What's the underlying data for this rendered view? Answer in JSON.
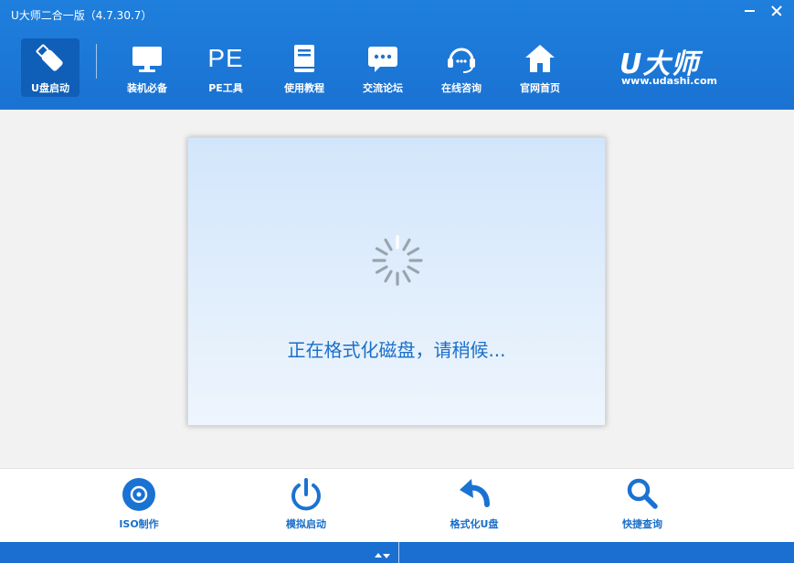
{
  "window": {
    "title": "U大师二合一版（4.7.30.7）"
  },
  "nav": {
    "items": [
      {
        "label": "U盘启动",
        "icon": "usb-drive-icon",
        "active": true
      },
      {
        "label": "装机必备",
        "icon": "monitor-icon"
      },
      {
        "label": "PE工具",
        "icon": "pe-icon",
        "icon_text": "PE"
      },
      {
        "label": "使用教程",
        "icon": "book-icon"
      },
      {
        "label": "交流论坛",
        "icon": "chat-bubble-icon"
      },
      {
        "label": "在线咨询",
        "icon": "headset-icon"
      },
      {
        "label": "官网首页",
        "icon": "home-icon"
      }
    ]
  },
  "brand": {
    "logo_text": "U大师",
    "url": "www.udashi.com"
  },
  "main": {
    "status_text": "正在格式化磁盘，请稍候..."
  },
  "toolbar": {
    "items": [
      {
        "label": "ISO制作",
        "icon": "disc-icon"
      },
      {
        "label": "模拟启动",
        "icon": "power-icon"
      },
      {
        "label": "格式化U盘",
        "icon": "undo-arrow-icon"
      },
      {
        "label": "快捷查询",
        "icon": "search-icon"
      }
    ]
  },
  "colors": {
    "header_bg": "#1f7fdc",
    "active_tab_bg": "#0f5fb8",
    "accent_text": "#1a6fc8",
    "statusbar_bg": "#1a6fd0"
  }
}
